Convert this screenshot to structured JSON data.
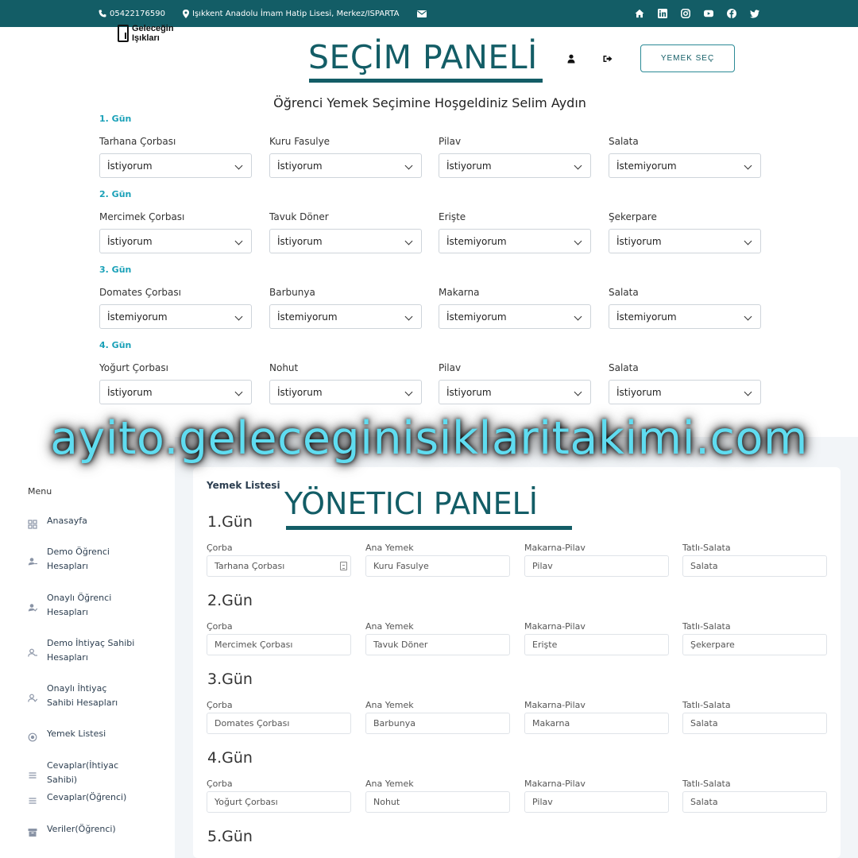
{
  "topbar": {
    "phone": "05422176590",
    "address": "Işıkkent Anadolu İmam Hatip Lisesi, Merkez/ISPARTA",
    "social_icons": [
      "home-icon",
      "linkedin-icon",
      "instagram-icon",
      "youtube-icon",
      "facebook-icon",
      "twitter-icon"
    ]
  },
  "header": {
    "logo_line1": "Geleceğin",
    "logo_line2": "Işıkları",
    "headline": "SEÇİM PANELİ",
    "button": "YEMEK SEÇ"
  },
  "selection": {
    "welcome": "Öğrenci Yemek Seçimine Hoşgeldiniz Selim Aydın",
    "days": [
      {
        "title": "1. Gün",
        "meals": [
          {
            "label": "Tarhana Çorbası",
            "value": "İstiyorum"
          },
          {
            "label": "Kuru Fasulye",
            "value": "İstiyorum"
          },
          {
            "label": "Pilav",
            "value": "İstiyorum"
          },
          {
            "label": "Salata",
            "value": "İstemiyorum"
          }
        ]
      },
      {
        "title": "2. Gün",
        "meals": [
          {
            "label": "Mercimek Çorbası",
            "value": "İstiyorum"
          },
          {
            "label": "Tavuk Döner",
            "value": "İstiyorum"
          },
          {
            "label": "Erişte",
            "value": "İstemiyorum"
          },
          {
            "label": "Şekerpare",
            "value": "İstiyorum"
          }
        ]
      },
      {
        "title": "3. Gün",
        "meals": [
          {
            "label": "Domates Çorbası",
            "value": "İstemiyorum"
          },
          {
            "label": "Barbunya",
            "value": "İstemiyorum"
          },
          {
            "label": "Makarna",
            "value": "İstemiyorum"
          },
          {
            "label": "Salata",
            "value": "İstemiyorum"
          }
        ]
      },
      {
        "title": "4. Gün",
        "meals": [
          {
            "label": "Yoğurt Çorbası",
            "value": "İstiyorum"
          },
          {
            "label": "Nohut",
            "value": "İstiyorum"
          },
          {
            "label": "Pilav",
            "value": "İstiyorum"
          },
          {
            "label": "Salata",
            "value": "İstiyorum"
          }
        ]
      }
    ]
  },
  "watermark": "ayito.geleceginisiklaritakimi.com",
  "admin": {
    "menu_title": "Menu",
    "menu": [
      {
        "label": "Anasayfa",
        "icon": "grid-icon"
      },
      {
        "label": "Demo Öğrenci Hesapları",
        "icon": "user-add-icon"
      },
      {
        "label": "Onaylı Öğrenci Hesapları",
        "icon": "user-check-icon"
      },
      {
        "label": "Demo İhtiyaç Sahibi Hesapları",
        "icon": "user-outline-icon"
      },
      {
        "label": "Onaylı İhtiyaç Sahibi Hesapları",
        "icon": "user-check-outline-icon"
      },
      {
        "label": "Yemek Listesi",
        "icon": "target-icon"
      },
      {
        "label": "Cevaplar(İhtiyac Sahibi)",
        "icon": "list-icon"
      },
      {
        "label": "Cevaplar(Öğrenci)",
        "icon": "list-icon"
      },
      {
        "label": "Veriler(Öğrenci)",
        "icon": "archive-icon"
      }
    ],
    "card_title": "Yemek Listesi",
    "headline": "YÖNETICI PANELİ",
    "columns": [
      "Çorba",
      "Ana Yemek",
      "Makarna-Pilav",
      "Tatlı-Salata"
    ],
    "days": [
      {
        "title": "1.Gün",
        "values": [
          "Tarhana Çorbası",
          "Kuru Fasulye",
          "Pilav",
          "Salata"
        ]
      },
      {
        "title": "2.Gün",
        "values": [
          "Mercimek Çorbası",
          "Tavuk Döner",
          "Erişte",
          "Şekerpare"
        ]
      },
      {
        "title": "3.Gün",
        "values": [
          "Domates Çorbası",
          "Barbunya",
          "Makarna",
          "Salata"
        ]
      },
      {
        "title": "4.Gün",
        "values": [
          "Yoğurt Çorbası",
          "Nohut",
          "Pilav",
          "Salata"
        ]
      },
      {
        "title": "5.Gün",
        "values": []
      }
    ]
  }
}
